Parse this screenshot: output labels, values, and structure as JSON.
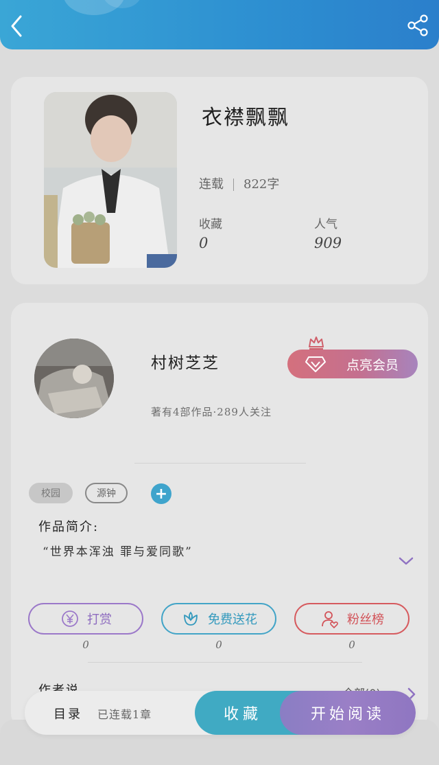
{
  "colors": {
    "header_gradient_start": "#3aa6d6",
    "header_gradient_end": "#2b7fcb",
    "accent_blue": "#40aac3",
    "accent_purple": "#9b78c9",
    "accent_red": "#d65a5e",
    "vip_gradient_start": "#d4707d",
    "vip_gradient_end": "#a784bd"
  },
  "header": {
    "back_icon": "chevron-left-icon",
    "share_icon": "share-icon"
  },
  "book": {
    "title": "衣襟飘飘",
    "status": "连载",
    "word_count": "822字",
    "collect_label": "收藏",
    "collect_value": "0",
    "popularity_label": "人气",
    "popularity_value": "909"
  },
  "author": {
    "name": "村树芝芝",
    "meta": "著有4部作品·289人关注",
    "vip_button": "点亮会员"
  },
  "tags": {
    "items": [
      "校园",
      "源钟"
    ],
    "add_symbol": "+"
  },
  "intro": {
    "label": "作品简介:",
    "text": "“世界本浑浊 罪与爱同歌”"
  },
  "actions": [
    {
      "label": "打赏",
      "count": "0",
      "icon": "yen-coin-icon"
    },
    {
      "label": "免费送花",
      "count": "0",
      "icon": "flower-icon"
    },
    {
      "label": "粉丝榜",
      "count": "0",
      "icon": "fan-ranking-icon"
    }
  ],
  "author_says": {
    "label": "作者说",
    "all_comments": "全部(0)"
  },
  "bottom_bar": {
    "toc_label": "目录",
    "toc_sub": "已连载1章",
    "collect_button": "收藏",
    "read_button": "开始阅读"
  }
}
